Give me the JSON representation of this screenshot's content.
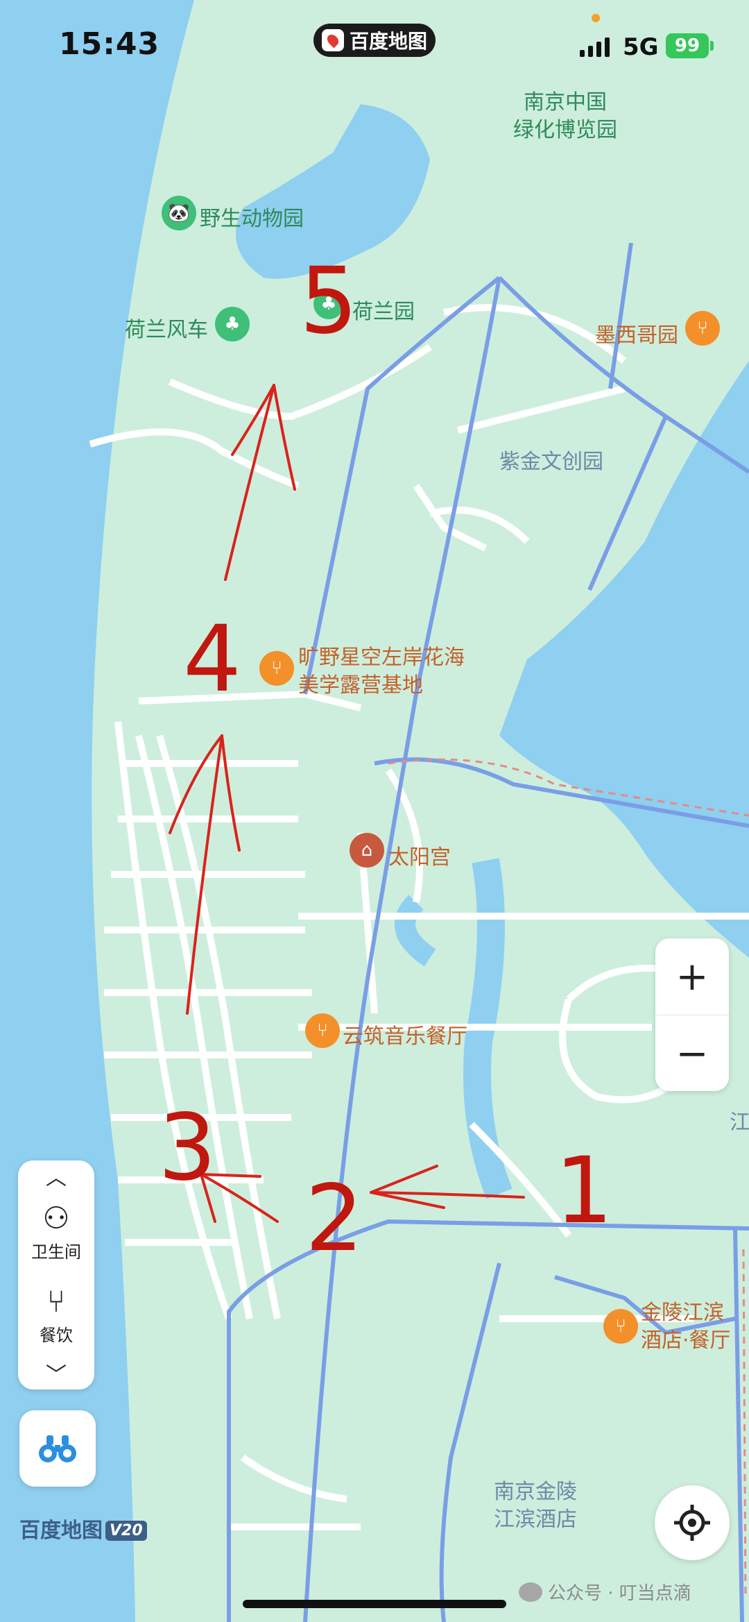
{
  "status_bar": {
    "time": "15:43",
    "app_pill": "百度地图",
    "network": "5G",
    "battery": "99"
  },
  "map_labels": {
    "expo_garden": "南京中国\n绿化博览园",
    "wildlife_park": "野生动物园",
    "dutch_windmill": "荷兰风车",
    "dutch_garden": "荷兰园",
    "mexico_garden": "墨西哥园",
    "zijin_park": "紫金文创园",
    "camping_base": "旷野星空左岸花海\n美学露营基地",
    "sun_palace": "太阳宫",
    "music_restaurant": "云筑音乐餐厅",
    "jinling_restaurant": "金陵江滨\n酒店·餐厅",
    "jinling_hotel": "南京金陵\n江滨酒店",
    "edge_label": "江"
  },
  "annotations": [
    "1",
    "2",
    "3",
    "4",
    "5"
  ],
  "controls": {
    "zoom_in": "+",
    "zoom_out": "−",
    "restroom": "卫生间",
    "dining": "餐饮"
  },
  "brand": {
    "name": "百度地图",
    "version": "V20"
  },
  "watermark": "公众号 · 叮当点滴",
  "colors": {
    "water": "#8fcff0",
    "land": "#cdeedd",
    "road": "#ffffff",
    "main_road": "#7a9ee6",
    "annotation": "#c0170f"
  }
}
